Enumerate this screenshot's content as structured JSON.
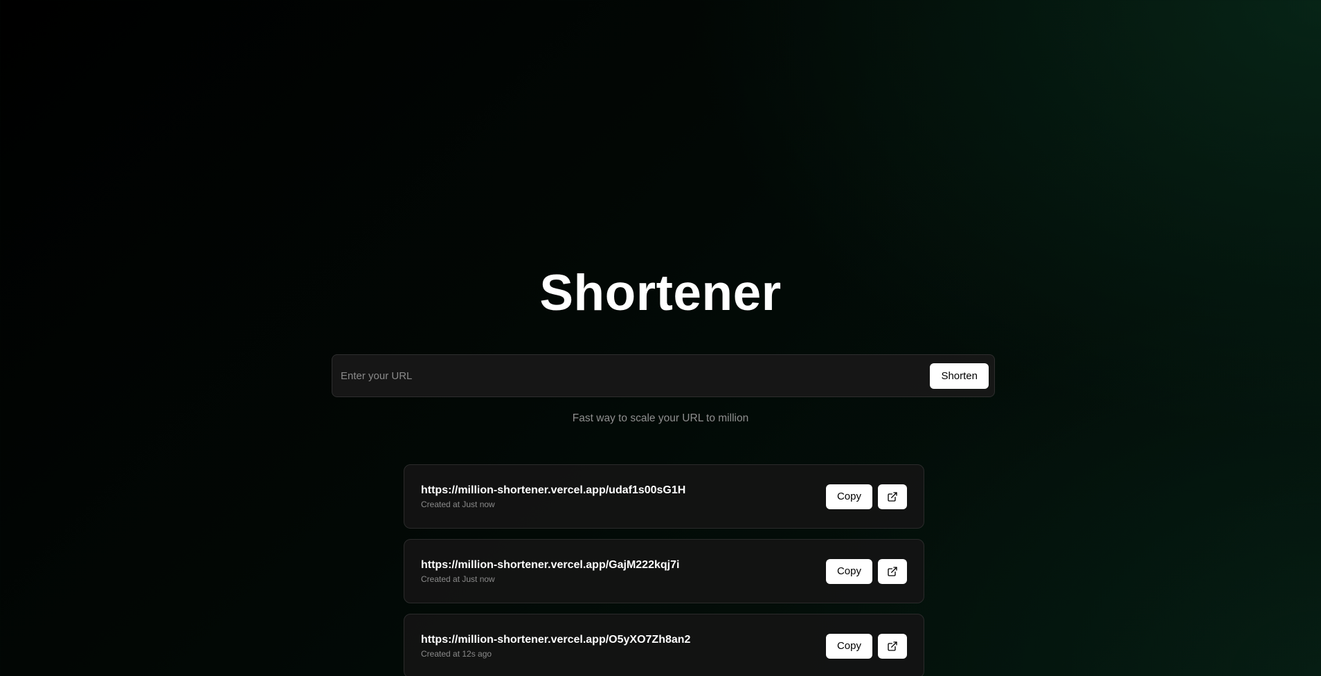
{
  "header": {
    "title": "Shortener"
  },
  "form": {
    "input_value": "",
    "input_placeholder": "Enter your URL",
    "submit_label": "Shorten"
  },
  "tagline": "Fast way to scale your URL to million",
  "links": [
    {
      "url": "https://million-shortener.vercel.app/udaf1s00sG1H",
      "created": "Created at Just now",
      "copy_label": "Copy",
      "open_icon": "external-link-icon"
    },
    {
      "url": "https://million-shortener.vercel.app/GajM222kqj7i",
      "created": "Created at Just now",
      "copy_label": "Copy",
      "open_icon": "external-link-icon"
    },
    {
      "url": "https://million-shortener.vercel.app/O5yXO7Zh8an2",
      "created": "Created at 12s ago",
      "copy_label": "Copy",
      "open_icon": "external-link-icon"
    }
  ],
  "colors": {
    "background": "#000000",
    "accent_glow": "#0a3722",
    "card_border": "#2b2b2b",
    "button_bg": "#ffffff",
    "button_text": "#000000",
    "muted_text": "#8a8a8a"
  }
}
